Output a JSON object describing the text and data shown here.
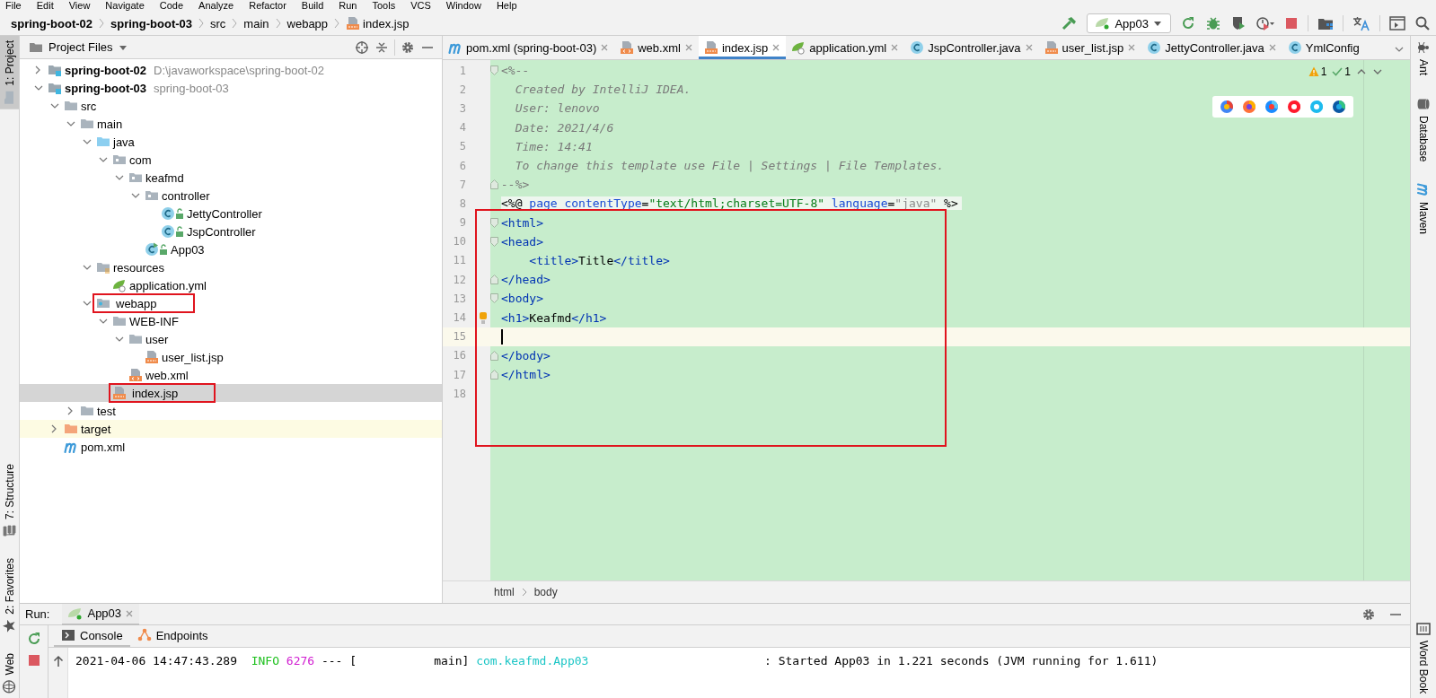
{
  "menu": [
    "File",
    "Edit",
    "View",
    "Navigate",
    "Code",
    "Analyze",
    "Refactor",
    "Build",
    "Run",
    "Tools",
    "VCS",
    "Window",
    "Help"
  ],
  "breadcrumbs": [
    {
      "label": "spring-boot-02",
      "bold": true
    },
    {
      "label": "spring-boot-03",
      "bold": true
    },
    {
      "label": "src",
      "bold": false
    },
    {
      "label": "main",
      "bold": false
    },
    {
      "label": "webapp",
      "bold": false
    },
    {
      "label": "index.jsp",
      "bold": false,
      "kind": "jsp"
    }
  ],
  "run_config": {
    "label": "App03"
  },
  "left_stripe": {
    "top": [
      {
        "label": "1: Project",
        "kind": "folder",
        "selected": true
      }
    ],
    "bottom": [
      {
        "label": "7: Structure",
        "kind": "structure",
        "selected": false
      },
      {
        "label": "2: Favorites",
        "kind": "star",
        "selected": false
      },
      {
        "label": "Web",
        "kind": "globe",
        "selected": false
      }
    ]
  },
  "right_stripe": {
    "top": [
      {
        "label": "Ant",
        "kind": "ant",
        "selected": false
      },
      {
        "label": "Database",
        "kind": "database",
        "selected": false
      },
      {
        "label": "Maven",
        "kind": "maven",
        "selected": false
      }
    ],
    "bottom": [
      {
        "label": "Word Book",
        "kind": "book",
        "selected": false
      }
    ]
  },
  "project": {
    "title": "Project Files",
    "tree": [
      {
        "label": "spring-boot-02",
        "bold": true,
        "hint": "D:\\javaworkspace\\spring-boot-02",
        "kind": "module",
        "expanded": false,
        "selected": false
      },
      {
        "label": "spring-boot-03",
        "bold": true,
        "hint": "spring-boot-03",
        "kind": "module",
        "expanded": true,
        "selected": false,
        "children": [
          {
            "label": "src",
            "kind": "folder",
            "expanded": true,
            "selected": false,
            "children": [
              {
                "label": "main",
                "kind": "folder",
                "expanded": true,
                "selected": false,
                "children": [
                  {
                    "label": "java",
                    "kind": "sourcefolder",
                    "expanded": true,
                    "selected": false,
                    "children": [
                      {
                        "label": "com",
                        "kind": "package",
                        "expanded": true,
                        "selected": false,
                        "children": [
                          {
                            "label": "keafmd",
                            "kind": "package",
                            "expanded": true,
                            "selected": false,
                            "children": [
                              {
                                "label": "controller",
                                "kind": "package",
                                "expanded": true,
                                "selected": false,
                                "children": [
                                  {
                                    "label": "JettyController",
                                    "kind": "class",
                                    "public": true,
                                    "selected": false
                                  },
                                  {
                                    "label": "JspController",
                                    "kind": "class",
                                    "public": true,
                                    "selected": false
                                  }
                                ]
                              },
                              {
                                "label": "App03",
                                "kind": "mainclass",
                                "public": true,
                                "selected": false
                              }
                            ]
                          }
                        ]
                      }
                    ]
                  },
                  {
                    "label": "resources",
                    "kind": "resources",
                    "expanded": true,
                    "selected": false,
                    "children": [
                      {
                        "label": "application.yml",
                        "kind": "yml",
                        "selected": false
                      }
                    ]
                  },
                  {
                    "label": "webapp",
                    "kind": "webfolder",
                    "expanded": true,
                    "selected": false,
                    "annotated": true,
                    "children": [
                      {
                        "label": "WEB-INF",
                        "kind": "folder",
                        "expanded": true,
                        "selected": false,
                        "children": [
                          {
                            "label": "user",
                            "kind": "folder",
                            "expanded": true,
                            "selected": false,
                            "children": [
                              {
                                "label": "user_list.jsp",
                                "kind": "jsp",
                                "selected": false
                              }
                            ]
                          },
                          {
                            "label": "web.xml",
                            "kind": "xml",
                            "selected": false
                          }
                        ]
                      },
                      {
                        "label": "index.jsp",
                        "kind": "jsp",
                        "selected": true,
                        "annotated": true
                      }
                    ]
                  }
                ]
              },
              {
                "label": "test",
                "kind": "folder",
                "expanded": false,
                "selected": false
              }
            ]
          },
          {
            "label": "target",
            "kind": "excluded",
            "expanded": false,
            "selected": false,
            "highlighted": true
          },
          {
            "label": "pom.xml",
            "kind": "maven",
            "selected": false
          }
        ]
      }
    ]
  },
  "editor": {
    "tabs": [
      {
        "label": "pom.xml (spring-boot-03)",
        "kind": "maven",
        "selected": false,
        "closable": true
      },
      {
        "label": "web.xml",
        "kind": "xml",
        "selected": false,
        "closable": true
      },
      {
        "label": "index.jsp",
        "kind": "jsp",
        "selected": true,
        "closable": true
      },
      {
        "label": "application.yml",
        "kind": "yml",
        "selected": false,
        "closable": true
      },
      {
        "label": "JspController.java",
        "kind": "class",
        "selected": false,
        "closable": true
      },
      {
        "label": "user_list.jsp",
        "kind": "jsp",
        "selected": false,
        "closable": true
      },
      {
        "label": "JettyController.java",
        "kind": "class",
        "selected": false,
        "closable": true
      },
      {
        "label": "YmlConfig",
        "kind": "class",
        "selected": false,
        "closable": false
      }
    ],
    "warnings": "1",
    "weak_warnings": "1",
    "annotation_box": true,
    "lines": [
      {
        "number": "1",
        "kind": "foldstart",
        "current": false,
        "tokens": [
          {
            "text": "<%--",
            "kind": "comment"
          }
        ]
      },
      {
        "number": "2",
        "kind": "plain",
        "current": false,
        "tokens": [
          {
            "text": "  Created by IntelliJ IDEA.",
            "kind": "comment"
          }
        ]
      },
      {
        "number": "3",
        "kind": "plain",
        "current": false,
        "tokens": [
          {
            "text": "  User: lenovo",
            "kind": "comment"
          }
        ]
      },
      {
        "number": "4",
        "kind": "plain",
        "current": false,
        "tokens": [
          {
            "text": "  Date: 2021/4/6",
            "kind": "comment"
          }
        ]
      },
      {
        "number": "5",
        "kind": "plain",
        "current": false,
        "tokens": [
          {
            "text": "  Time: 14:41",
            "kind": "comment"
          }
        ]
      },
      {
        "number": "6",
        "kind": "plain",
        "current": false,
        "tokens": [
          {
            "text": "  To change this template use File | Settings | File Templates.",
            "kind": "comment"
          }
        ]
      },
      {
        "number": "7",
        "kind": "foldend",
        "current": false,
        "tokens": [
          {
            "text": "--%>",
            "kind": "comment"
          }
        ]
      },
      {
        "number": "8",
        "kind": "plain",
        "current": false,
        "injected": true,
        "tokens": [
          {
            "text": "<%@",
            "kind": "plain"
          },
          {
            "text": " page contentType",
            "kind": "attr"
          },
          {
            "text": "=",
            "kind": "plain"
          },
          {
            "text": "\"text/html;charset=UTF-8\"",
            "kind": "string"
          },
          {
            "text": " language",
            "kind": "attr"
          },
          {
            "text": "=",
            "kind": "plain"
          },
          {
            "text": "\"java\"",
            "kind": "muted"
          },
          {
            "text": " %>",
            "kind": "plain"
          }
        ]
      },
      {
        "number": "9",
        "kind": "foldstart",
        "current": false,
        "tokens": [
          {
            "text": "<html>",
            "kind": "tag"
          }
        ]
      },
      {
        "number": "10",
        "kind": "foldstart",
        "current": false,
        "tokens": [
          {
            "text": "<head>",
            "kind": "tag"
          }
        ]
      },
      {
        "number": "11",
        "kind": "plain",
        "current": false,
        "tokens": [
          {
            "text": "    <title>",
            "kind": "tag"
          },
          {
            "text": "Title",
            "kind": "plain"
          },
          {
            "text": "</title>",
            "kind": "tag"
          }
        ]
      },
      {
        "number": "12",
        "kind": "foldend",
        "current": false,
        "tokens": [
          {
            "text": "</head>",
            "kind": "tag"
          }
        ]
      },
      {
        "number": "13",
        "kind": "foldstart",
        "current": false,
        "tokens": [
          {
            "text": "<body>",
            "kind": "tag"
          }
        ]
      },
      {
        "number": "14",
        "kind": "plain",
        "current": false,
        "bulb": true,
        "tokens": [
          {
            "text": "<h1>",
            "kind": "tag"
          },
          {
            "text": "Keafmd",
            "kind": "plain"
          },
          {
            "text": "</h1>",
            "kind": "tag"
          }
        ]
      },
      {
        "number": "15",
        "kind": "plain",
        "current": true
      },
      {
        "number": "16",
        "kind": "foldend",
        "current": false,
        "tokens": [
          {
            "text": "</body>",
            "kind": "tag"
          }
        ]
      },
      {
        "number": "17",
        "kind": "foldend",
        "current": false,
        "tokens": [
          {
            "text": "</html>",
            "kind": "tag"
          }
        ]
      },
      {
        "number": "18",
        "kind": "plain",
        "current": false
      }
    ],
    "path": [
      "html",
      "body"
    ]
  },
  "run": {
    "label": "Run:",
    "tabs": [
      {
        "label": "App03",
        "selected": true
      }
    ],
    "console_tabs": [
      {
        "label": "Console",
        "kind": "console",
        "selected": true
      },
      {
        "label": "Endpoints",
        "kind": "endpoints",
        "selected": false
      }
    ],
    "lines": [
      {
        "tokens": [
          {
            "text": "2021-04-06 14:47:43.289  ",
            "kind": "plain"
          },
          {
            "text": "INFO ",
            "kind": "info"
          },
          {
            "text": "6276",
            "kind": "pid"
          },
          {
            "text": " --- [           main] ",
            "kind": "plain"
          },
          {
            "text": "com.keafmd.App03",
            "kind": "logger"
          },
          {
            "text": "                         : Started App03 in 1.221 seconds (JVM running for 1.611)",
            "kind": "plain"
          }
        ]
      }
    ]
  }
}
